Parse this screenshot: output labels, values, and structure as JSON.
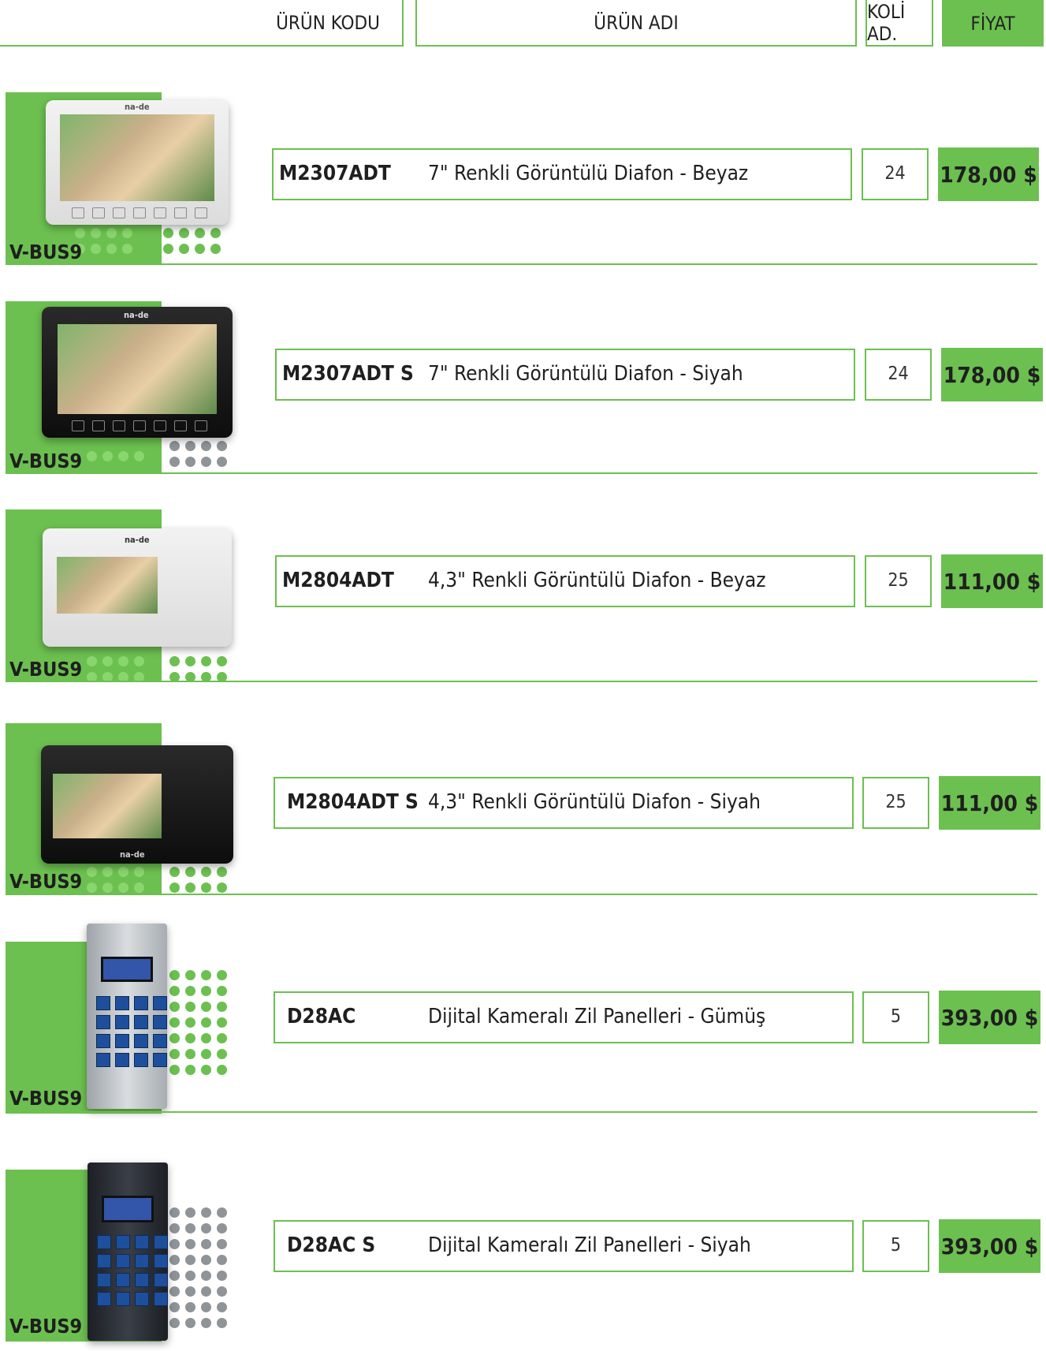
{
  "header": {
    "code_label": "ÜRÜN KODU",
    "name_label": "ÜRÜN ADI",
    "qty_label": "KOLİ AD.",
    "price_label": "FİYAT"
  },
  "colors": {
    "accent": "#6cc050"
  },
  "rows": [
    {
      "series": "V-BUS9",
      "code": "M2307ADT",
      "name": "7\" Renkli Görüntülü Diafon - Beyaz",
      "qty": "24",
      "price": "178,00 $",
      "device": "monitor-7-white"
    },
    {
      "series": "V-BUS9",
      "code": "M2307ADT S",
      "name": "7\" Renkli Görüntülü Diafon - Siyah",
      "qty": "24",
      "price": "178,00 $",
      "device": "monitor-7-black"
    },
    {
      "series": "V-BUS9",
      "code": "M2804ADT",
      "name": "4,3\" Renkli Görüntülü Diafon - Beyaz",
      "qty": "25",
      "price": "111,00 $",
      "device": "monitor-4-white"
    },
    {
      "series": "V-BUS9",
      "code": "M2804ADT S",
      "name": "4,3\" Renkli Görüntülü Diafon - Siyah",
      "qty": "25",
      "price": "111,00 $",
      "device": "monitor-4-black"
    },
    {
      "series": "V-BUS9",
      "code": "D28AC",
      "name": "Dijital Kameralı Zil Panelleri - Gümüş",
      "qty": "5",
      "price": "393,00 $",
      "device": "door-panel-silver"
    },
    {
      "series": "V-BUS9",
      "code": "D28AC S",
      "name": "Dijital Kameralı Zil Panelleri - Siyah",
      "qty": "5",
      "price": "393,00 $",
      "device": "door-panel-black"
    }
  ],
  "brand_text": "na-de"
}
